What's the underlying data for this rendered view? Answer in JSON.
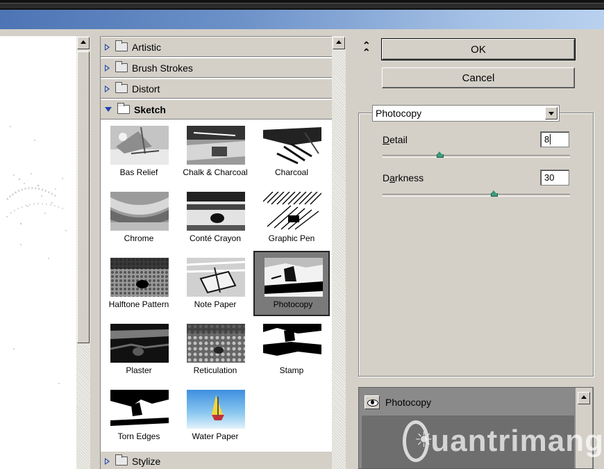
{
  "filter_list": {
    "categories_top": [
      "Artistic",
      "Brush Strokes",
      "Distort"
    ],
    "open_category": "Sketch",
    "bottom_category": "Stylize",
    "thumbnails": [
      {
        "label": "Bas Relief",
        "icon": "bas-relief-thumbnail"
      },
      {
        "label": "Chalk & Charcoal",
        "icon": "chalk-charcoal-thumbnail"
      },
      {
        "label": "Charcoal",
        "icon": "charcoal-thumbnail"
      },
      {
        "label": "Chrome",
        "icon": "chrome-thumbnail"
      },
      {
        "label": "Conté Crayon",
        "icon": "conte-crayon-thumbnail"
      },
      {
        "label": "Graphic Pen",
        "icon": "graphic-pen-thumbnail"
      },
      {
        "label": "Halftone Pattern",
        "icon": "halftone-pattern-thumbnail"
      },
      {
        "label": "Note Paper",
        "icon": "note-paper-thumbnail"
      },
      {
        "label": "Photocopy",
        "icon": "photocopy-thumbnail"
      },
      {
        "label": "Plaster",
        "icon": "plaster-thumbnail"
      },
      {
        "label": "Reticulation",
        "icon": "reticulation-thumbnail"
      },
      {
        "label": "Stamp",
        "icon": "stamp-thumbnail"
      },
      {
        "label": "Torn Edges",
        "icon": "torn-edges-thumbnail"
      },
      {
        "label": "Water Paper",
        "icon": "water-paper-thumbnail"
      }
    ],
    "selected": "Photocopy"
  },
  "buttons": {
    "ok": "OK",
    "cancel": "Cancel"
  },
  "settings": {
    "filter_select": "Photocopy",
    "detail": {
      "label_first": "D",
      "label_rest": "etail",
      "value": "8",
      "slider_value": 8,
      "slider_min": 1,
      "slider_max": 24
    },
    "darkness": {
      "label_first": "D",
      "label_underlined": "a",
      "label_rest": "rkness",
      "value": "30",
      "slider_value": 30,
      "slider_min": 1,
      "slider_max": 50
    }
  },
  "layers": {
    "name": "Photocopy"
  },
  "watermark": {
    "text": "uantrimang"
  },
  "colors": {
    "title_gradient_start": "#4d74b4",
    "selected_thumb_bg": "#7a7a7a",
    "slider_thumb": "#3aa07f"
  }
}
